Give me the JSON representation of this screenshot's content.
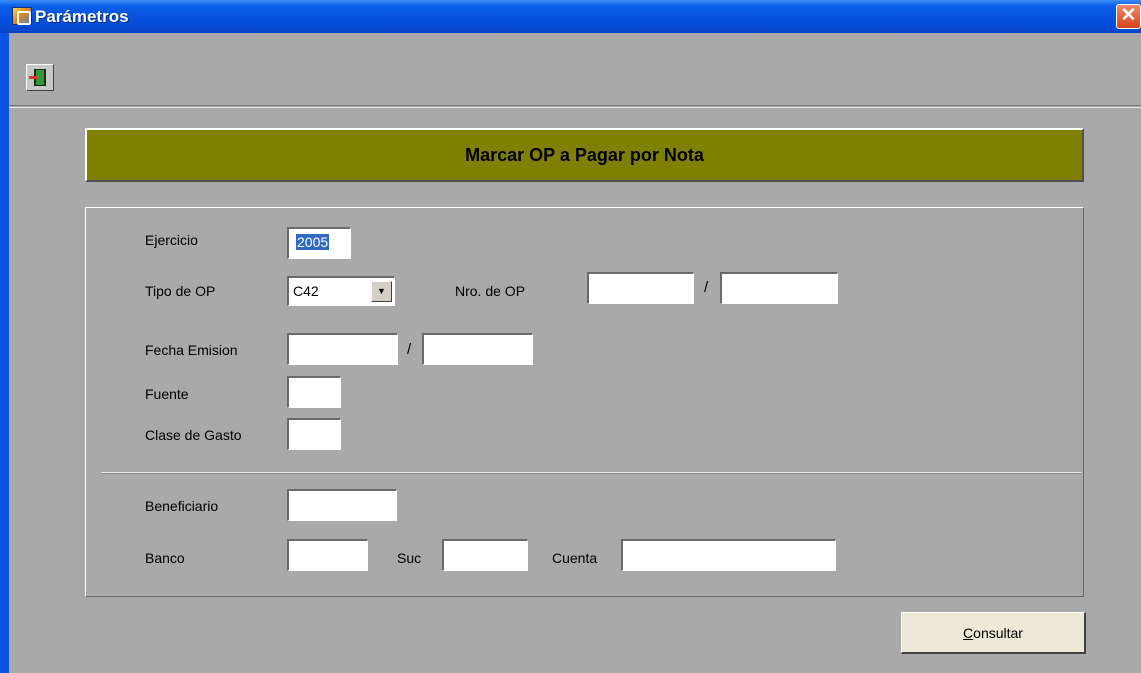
{
  "window": {
    "title": "Parámetros",
    "close_glyph": "✕",
    "accent": "#0550dd"
  },
  "toolbar": {
    "exit_icon": "exit-door-icon"
  },
  "header": {
    "title": "Marcar OP a Pagar por Nota",
    "bg_color": "#808000"
  },
  "form": {
    "ejercicio": {
      "label": "Ejercicio",
      "value": "2005"
    },
    "tipo_op": {
      "label": "Tipo de OP",
      "value": "C42",
      "arrow": "▼"
    },
    "nro_op": {
      "label": "Nro. de OP",
      "from": "",
      "to": "",
      "separator": "/"
    },
    "fecha_emision": {
      "label": "Fecha Emision",
      "from": "",
      "to": "",
      "separator": "/"
    },
    "fuente": {
      "label": "Fuente",
      "value": ""
    },
    "clase_gasto": {
      "label": "Clase de Gasto",
      "value": ""
    },
    "beneficiario": {
      "label": "Beneficiario",
      "value": ""
    },
    "banco": {
      "label": "Banco",
      "value": ""
    },
    "suc": {
      "label": "Suc",
      "value": ""
    },
    "cuenta": {
      "label": "Cuenta",
      "value": ""
    }
  },
  "actions": {
    "consultar_first": "C",
    "consultar_rest": "onsultar"
  }
}
